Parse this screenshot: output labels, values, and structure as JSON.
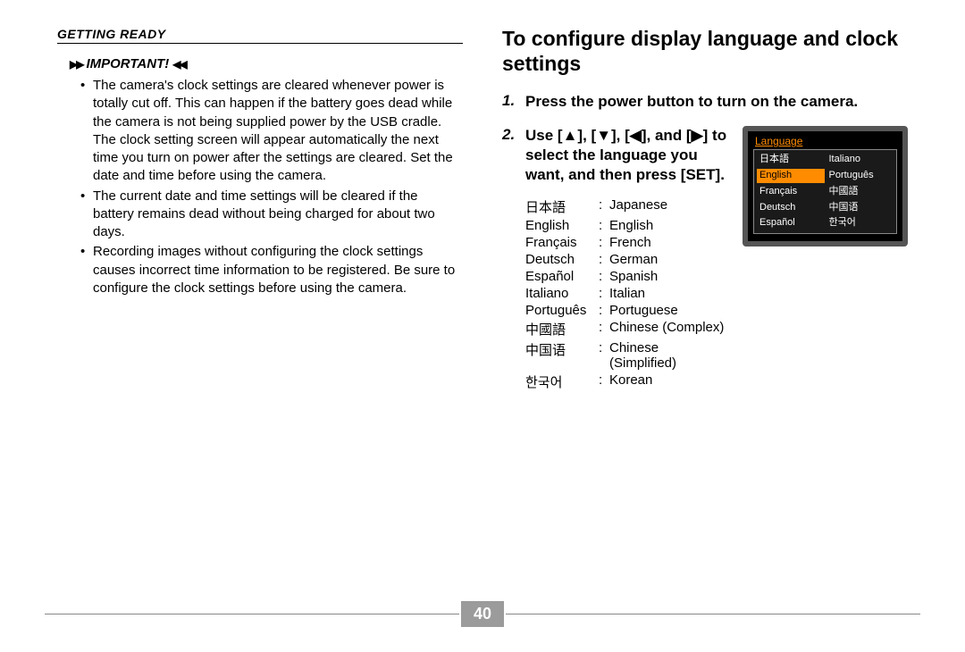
{
  "header": {
    "section": "GETTING READY"
  },
  "important": {
    "label": "IMPORTANT!",
    "bullets": [
      "The camera's clock settings are cleared whenever power is totally cut off. This can happen if the battery goes dead while the camera is not being supplied power by the USB cradle. The clock setting screen will appear automatically the next time you turn on power after the settings are cleared. Set the date and time before using the camera.",
      "The current date and time settings will be cleared if the battery remains dead without being charged for about two days.",
      "Recording images without configuring the clock settings causes incorrect time information to be registered. Be sure to configure the clock settings before using the camera."
    ]
  },
  "title": "To configure display language and clock settings",
  "steps": {
    "s1": {
      "num": "1.",
      "text": "Press the power button to turn on the camera."
    },
    "s2": {
      "num": "2.",
      "text_a": "Use [",
      "text_b": "], [",
      "text_c": "], [",
      "text_d": "], and [",
      "text_e": "] to select the language you want, and then press [SET]."
    }
  },
  "arrows": {
    "up": "▲",
    "down": "▼",
    "left": "◀",
    "right": "▶"
  },
  "lang_table": [
    {
      "native": "日本語",
      "eng": "Japanese"
    },
    {
      "native": "English",
      "eng": "English"
    },
    {
      "native": "Français",
      "eng": "French"
    },
    {
      "native": "Deutsch",
      "eng": "German"
    },
    {
      "native": "Español",
      "eng": "Spanish"
    },
    {
      "native": "Italiano",
      "eng": "Italian"
    },
    {
      "native": "Português",
      "eng": "Portuguese"
    },
    {
      "native": "中國語",
      "eng": "Chinese (Complex)"
    },
    {
      "native": "中国语",
      "eng": "Chinese (Simplified)"
    },
    {
      "native": "한국어",
      "eng": "Korean"
    }
  ],
  "screen": {
    "title": "Language",
    "cells": [
      "日本語",
      "Italiano",
      "English",
      "Português",
      "Français",
      "中國語",
      "Deutsch",
      "中国语",
      "Español",
      "한국어"
    ],
    "selected_index": 2
  },
  "page_number": "40"
}
